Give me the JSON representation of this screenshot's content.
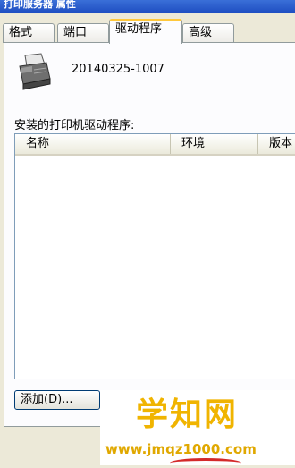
{
  "window": {
    "title": "打印服务器 属性"
  },
  "tabs": [
    {
      "label": "格式",
      "active": false
    },
    {
      "label": "端口",
      "active": false
    },
    {
      "label": "驱动程序",
      "active": true
    },
    {
      "label": "高级",
      "active": false
    }
  ],
  "printer": {
    "name": "20140325-1007",
    "icon": "printer-icon"
  },
  "drivers": {
    "label": "安装的打印机驱动程序:",
    "columns": [
      "名称",
      "环境",
      "版本"
    ],
    "rows": []
  },
  "buttons": {
    "add_label": "添加(D)..."
  },
  "watermark": {
    "title": "学知网",
    "url": "www.jmqz1000.com"
  },
  "colors": {
    "accent_tab": "#ffc83c",
    "watermark": "#f0b400"
  }
}
